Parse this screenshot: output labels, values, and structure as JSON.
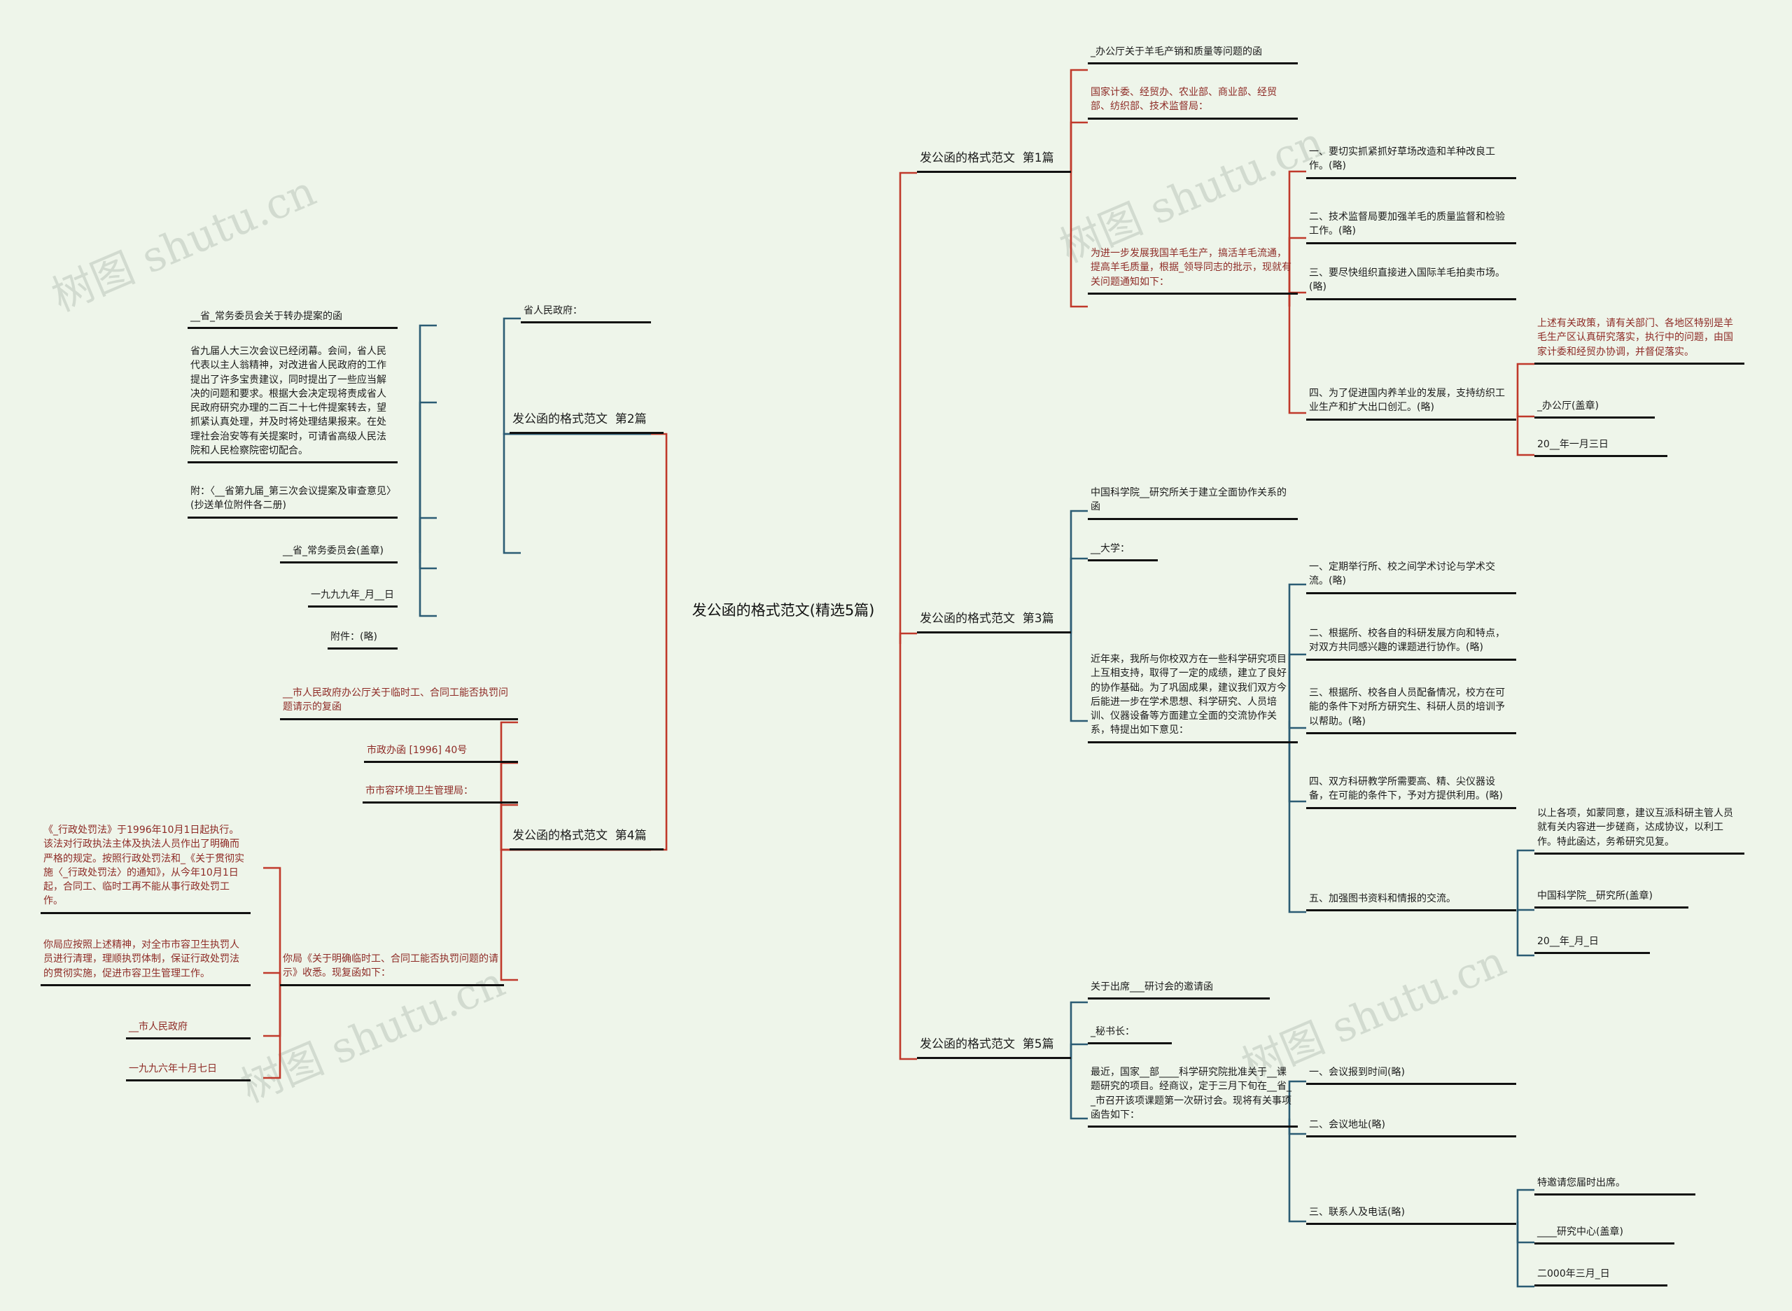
{
  "page": {
    "background_color": "#eef5ea",
    "link_color_red": "#c0392b",
    "link_color_blue": "#2b5c74",
    "text_color_black": "#1b1b1b",
    "text_color_red": "#8e2b26"
  },
  "watermarks": [
    "树图 shutu.cn",
    "树图 shutu.cn",
    "树图 shutu.cn",
    "树图 shutu.cn"
  ],
  "root": {
    "label": "发公函的格式范文(精选5篇)"
  },
  "branches": [
    {
      "id": "b1",
      "label": "发公函的格式范文  第1篇"
    },
    {
      "id": "b2",
      "label": "发公函的格式范文  第2篇"
    },
    {
      "id": "b3",
      "label": "发公函的格式范文  第3篇"
    },
    {
      "id": "b4",
      "label": "发公函的格式范文  第4篇"
    },
    {
      "id": "b5",
      "label": "发公函的格式范文  第5篇"
    }
  ],
  "b1_nodes": {
    "title": "_办公厅关于羊毛产销和质量等问题的函",
    "recipients": "国家计委、经贸办、农业部、商业部、经贸部、纺织部、技术监督局：",
    "body": "为进一步发展我国羊毛生产，搞活羊毛流通，提高羊毛质量，根据_领导同志的批示，现就有关问题通知如下：",
    "item1": "一、要切实抓紧抓好草场改造和羊种改良工作。(略)",
    "item2": "二、技术监督局要加强羊毛的质量监督和检验工作。(略)",
    "item3": "三、要尽快组织直接进入国际羊毛拍卖市场。(略)",
    "item4": "四、为了促进国内养羊业的发展，支持纺织工业生产和扩大出口创汇。(略)",
    "closing": "上述有关政策，请有关部门、各地区特别是羊毛生产区认真研究落实，执行中的问题，由国家计委和经贸办协调，并督促落实。",
    "signer": "_办公厅(盖章)",
    "date": "20__年一月三日"
  },
  "b2_nodes": {
    "title": "__省_常务委员会关于转办提案的函",
    "body": "省九届人大三次会议已经闭幕。会间，省人民代表以主人翁精神，对改进省人民政府的工作提出了许多宝贵建议，同时提出了一些应当解决的问题和要求。根据大会决定现将责成省人民政府研究办理的二百二十七件提案转去，望抓紧认真处理，并及时将处理结果报来。在处理社会治安等有关提案时，可请省高级人民法院和人民检察院密切配合。",
    "attachment_note": "附：〈__省第九届_第三次会议提案及审查意见〉(抄送单位附件各二册)",
    "signer": "__省_常务委员会(盖章)",
    "date": "一九九九年_月__日",
    "attachment": "附件：(略)",
    "recipient": "省人民政府："
  },
  "b3_nodes": {
    "title": "中国科学院__研究所关于建立全面协作关系的函",
    "recipient": "__大学：",
    "body": "近年来，我所与你校双方在一些科学研究项目上互相支持，取得了一定的成绩，建立了良好的协作基础。为了巩固成果，建议我们双方今后能进一步在学术思想、科学研究、人员培训、仪器设备等方面建立全面的交流协作关系，特提出如下意见：",
    "item1": "一、定期举行所、校之间学术讨论与学术交流。(略)",
    "item2": "二、根据所、校各自的科研发展方向和特点，对双方共同感兴趣的课题进行协作。(略)",
    "item3": "三、根据所、校各自人员配备情况，校方在可能的条件下对所方研究生、科研人员的培训予以帮助。(略)",
    "item4": "四、双方科研教学所需要高、精、尖仪器设备，在可能的条件下，予对方提供利用。(略)",
    "item5": "五、加强图书资料和情报的交流。",
    "closing": "以上各项，如蒙同意，建议互派科研主管人员就有关内容进一步磋商，达成协议，以利工作。特此函达，务希研究见复。",
    "signer": "中国科学院__研究所(盖章)",
    "date": "20__年_月_日"
  },
  "b4_nodes": {
    "title": "__市人民政府办公厅关于临时工、合同工能否执罚问题请示的复函",
    "doc_number": "市政办函 [1996] 40号",
    "recipient": "市市容环境卫生管理局：",
    "body": "你局《关于明确临时工、合同工能否执罚问题的请示》收悉。现复函如下：",
    "para1": "《_行政处罚法》于1996年10月1日起执行。该法对行政执法主体及执法人员作出了明确而严格的规定。按照行政处罚法和_《关于贯彻实施〈_行政处罚法〉的通知》，从今年10月1日起，合同工、临时工再不能从事行政处罚工作。",
    "para2": "你局应按照上述精神，对全市市容卫生执罚人员进行清理，理顺执罚体制，保证行政处罚法的贯彻实施，促进市容卫生管理工作。",
    "signer": "__市人民政府",
    "date": "一九九六年十月七日"
  },
  "b5_nodes": {
    "title": "关于出席___研讨会的邀请函",
    "recipient": "_秘书长：",
    "body": "最近，国家__部____科学研究院批准关于__课题研究的项目。经商议，定于三月下旬在__省__市召开该项课题第一次研讨会。现将有关事项函告如下：",
    "item1": "一、会议报到时间(略)",
    "item2": "二、会议地址(略)",
    "item3": "三、联系人及电话(略)",
    "closing": "特邀请您届时出席。",
    "signer": "____研究中心(盖章)",
    "date": "二000年三月_日"
  }
}
